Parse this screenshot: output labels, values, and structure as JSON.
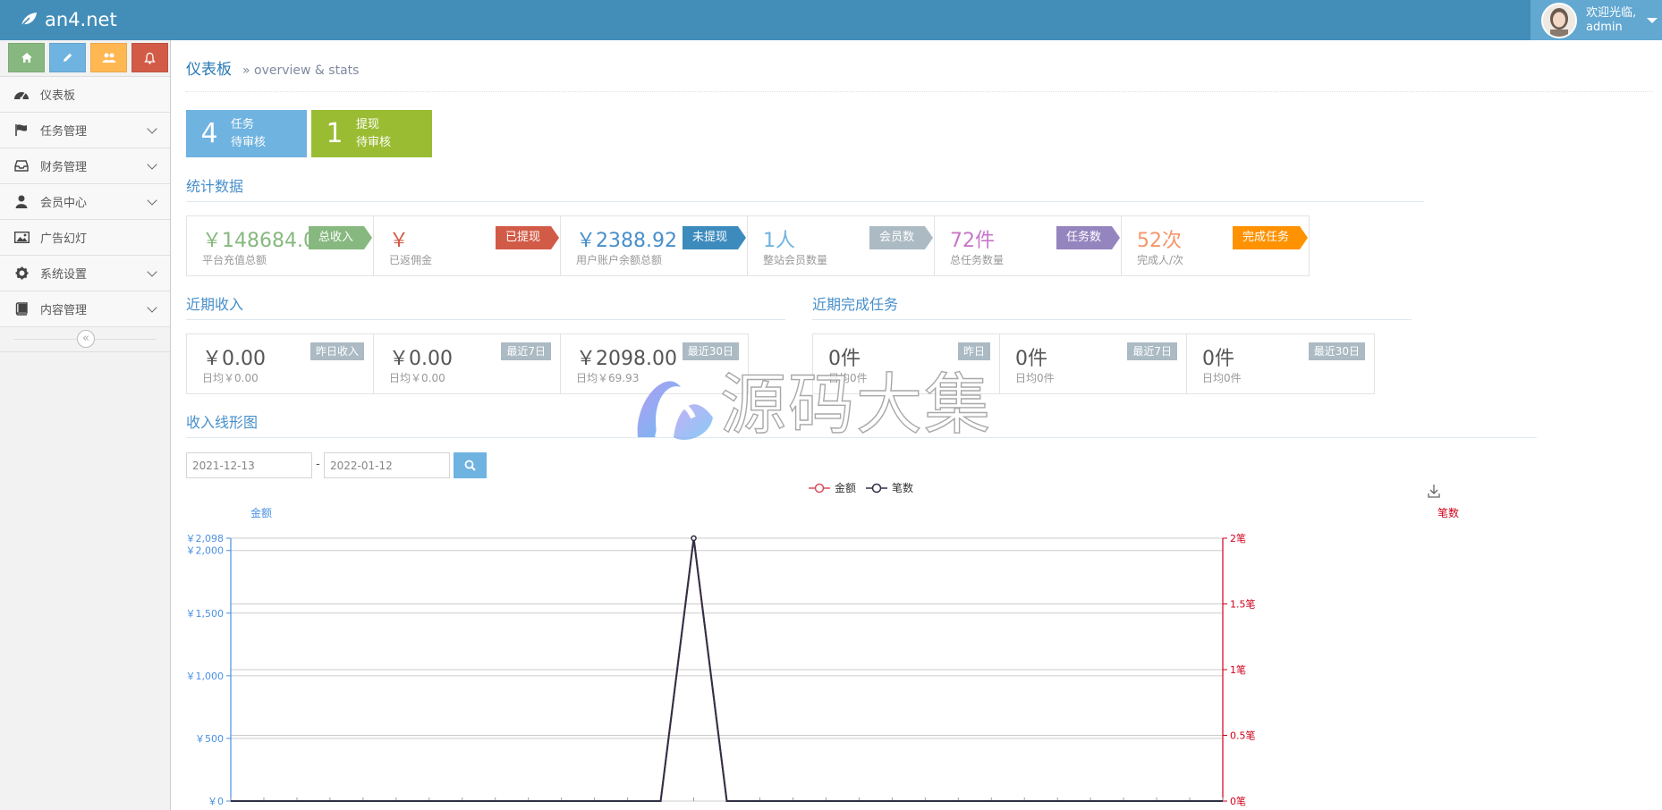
{
  "brand": {
    "name": "an4.net"
  },
  "user": {
    "greeting": "欢迎光临,",
    "name": "admin"
  },
  "sidebar": {
    "items": [
      {
        "label": "仪表板",
        "icon": "dashboard-icon",
        "has_sub": false
      },
      {
        "label": "任务管理",
        "icon": "flag-icon",
        "has_sub": true
      },
      {
        "label": "财务管理",
        "icon": "inbox-icon",
        "has_sub": true
      },
      {
        "label": "会员中心",
        "icon": "user-icon",
        "has_sub": true
      },
      {
        "label": "广告幻灯",
        "icon": "picture-icon",
        "has_sub": false
      },
      {
        "label": "系统设置",
        "icon": "gear-icon",
        "has_sub": true
      },
      {
        "label": "内容管理",
        "icon": "book-icon",
        "has_sub": true
      }
    ],
    "collapse_glyph": "«"
  },
  "header": {
    "title": "仪表板",
    "subtitle": "» overview & stats"
  },
  "pending": [
    {
      "count": "4",
      "line1": "任务",
      "line2": "待审核"
    },
    {
      "count": "1",
      "line1": "提现",
      "line2": "待审核"
    }
  ],
  "stats": {
    "title": "统计数据",
    "items": [
      {
        "value": "￥148684.0",
        "desc": "平台充值总额",
        "ribbon": "总收入",
        "value_color": "#87b87f",
        "ribbon_color": "#87b87f"
      },
      {
        "value": "￥",
        "desc": "已返佣金",
        "ribbon": "已提现",
        "value_color": "#d15b47",
        "ribbon_color": "#d15b47"
      },
      {
        "value": "￥2388.92",
        "desc": "用户账户余额总额",
        "ribbon": "未提现",
        "value_color": "#478fca",
        "ribbon_color": "#3d8bbd"
      },
      {
        "value": "1人",
        "desc": "整站会员数量",
        "ribbon": "会员数",
        "value_color": "#6fb3e0",
        "ribbon_color": "#abbac3"
      },
      {
        "value": "72件",
        "desc": "总任务数量",
        "ribbon": "任务数",
        "value_color": "#c876c8",
        "ribbon_color": "#9585bf"
      },
      {
        "value": "52次",
        "desc": "完成人/次",
        "ribbon": "完成任务",
        "value_color": "#f4976b",
        "ribbon_color": "#ff9200"
      }
    ]
  },
  "income": {
    "title": "近期收入",
    "items": [
      {
        "value": "￥0.00",
        "desc": "日均￥0.00",
        "badge": "昨日收入"
      },
      {
        "value": "￥0.00",
        "desc": "日均￥0.00",
        "badge": "最近7日"
      },
      {
        "value": "￥2098.00",
        "desc": "日均￥69.93",
        "badge": "最近30日"
      }
    ]
  },
  "tasks": {
    "title": "近期完成任务",
    "items": [
      {
        "value": "0件",
        "desc": "日均0件",
        "badge": "昨日"
      },
      {
        "value": "0件",
        "desc": "日均0件",
        "badge": "最近7日"
      },
      {
        "value": "0件",
        "desc": "日均0件",
        "badge": "最近30日"
      }
    ]
  },
  "chart_section": {
    "title": "收入线形图",
    "date_from": "2021-12-13",
    "date_to": "2022-01-12",
    "separator": "-"
  },
  "chart_data": {
    "type": "line",
    "legend": [
      "金额",
      "笔数"
    ],
    "legend_placement": "top-center",
    "y_left": {
      "name": "金额",
      "ticks": [
        "￥0",
        "￥500",
        "￥1,000",
        "￥1,500",
        "￥2,000",
        "￥2,098"
      ],
      "tick_values": [
        0,
        500,
        1000,
        1500,
        2000,
        2098
      ],
      "range": [
        0,
        2098
      ],
      "color": "#4a90e2"
    },
    "y_right": {
      "name": "笔数",
      "ticks": [
        "0笔",
        "0.5笔",
        "1笔",
        "1.5笔",
        "2笔"
      ],
      "tick_values": [
        0,
        0.5,
        1,
        1.5,
        2
      ],
      "range": [
        0,
        2
      ],
      "color": "#d0021b"
    },
    "point_count": 31,
    "series": [
      {
        "name": "金额",
        "axis": "left",
        "color": "#d94e5d",
        "values": [
          0,
          0,
          0,
          0,
          0,
          0,
          0,
          0,
          0,
          0,
          0,
          0,
          0,
          0,
          2098,
          0,
          0,
          0,
          0,
          0,
          0,
          0,
          0,
          0,
          0,
          0,
          0,
          0,
          0,
          0,
          0
        ]
      },
      {
        "name": "笔数",
        "axis": "right",
        "color": "#2f3046",
        "values": [
          0,
          0,
          0,
          0,
          0,
          0,
          0,
          0,
          0,
          0,
          0,
          0,
          0,
          0,
          2,
          0,
          0,
          0,
          0,
          0,
          0,
          0,
          0,
          0,
          0,
          0,
          0,
          0,
          0,
          0,
          0
        ]
      }
    ],
    "grid": true
  },
  "watermark": {
    "text": "源码大集"
  },
  "colors": {
    "navbar": "#438eb9",
    "accent": "#478fca"
  }
}
